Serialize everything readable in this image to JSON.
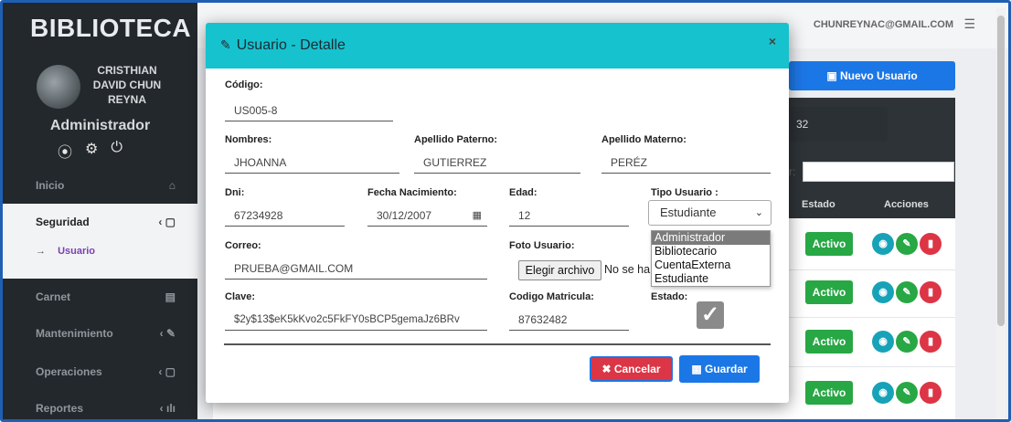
{
  "app": {
    "brand": "BIBLIOTECA"
  },
  "user": {
    "name": "CRISTHIAN DAVID CHUN REYNA",
    "role": "Administrador",
    "icons": [
      "user-circle-icon",
      "gear-icon",
      "power-icon"
    ]
  },
  "topbar": {
    "email": "CHUNREYNAC@GMAIL.COM",
    "menu_icon": "list-icon"
  },
  "sidebar": {
    "items": [
      {
        "label": "Inicio",
        "icon": "home-icon",
        "glyph": "⌂"
      },
      {
        "label": "Seguridad",
        "icon": "folder-icon",
        "glyph": "‹ ▢"
      },
      {
        "label": "Carnet",
        "icon": "id-card-icon",
        "glyph": "▤"
      },
      {
        "label": "Mantenimiento",
        "icon": "wrench-icon",
        "glyph": "‹ ✎"
      },
      {
        "label": "Operaciones",
        "icon": "folder-icon",
        "glyph": "‹ ▢"
      },
      {
        "label": "Reportes",
        "icon": "chart-icon",
        "glyph": "‹ ılı"
      }
    ],
    "subitem": {
      "label": "Usuario",
      "arrow": "→"
    }
  },
  "background": {
    "new_button": "Nuevo Usuario",
    "count": "32",
    "search_label": "r:",
    "headers": {
      "estado": "Estado",
      "acciones": "Acciones"
    },
    "rows": [
      {
        "estado": "Activo"
      },
      {
        "estado": "Activo"
      },
      {
        "estado": "Activo"
      },
      {
        "estado": "Activo"
      }
    ]
  },
  "modal": {
    "title": "Usuario - Detalle",
    "close": "×",
    "fields": {
      "codigo": {
        "label": "Código:",
        "value": "US005-8"
      },
      "nombres": {
        "label": "Nombres:",
        "value": "JHOANNA"
      },
      "apellido_paterno": {
        "label": "Apellido Paterno:",
        "value": "GUTIERREZ"
      },
      "apellido_materno": {
        "label": "Apellido Materno:",
        "value": "PERÉZ"
      },
      "dni": {
        "label": "Dni:",
        "value": "67234928"
      },
      "fecha_nacimiento": {
        "label": "Fecha Nacimiento:",
        "value": "30/12/2007"
      },
      "edad": {
        "label": "Edad:",
        "value": "12"
      },
      "tipo_usuario": {
        "label": "Tipo Usuario :",
        "value": "Estudiante",
        "options": [
          "Administrador",
          "Bibliotecario",
          "CuentaExterna",
          "Estudiante"
        ],
        "highlighted": "Administrador"
      },
      "correo": {
        "label": "Correo:",
        "value": "PRUEBA@GMAIL.COM"
      },
      "foto_usuario": {
        "label": "Foto Usuario:",
        "button": "Elegir archivo",
        "status": "No se ha"
      },
      "clave": {
        "label": "Clave:",
        "value": "$2y$13$eK5kKvo2c5FkFY0sBCP5gemaJz6BRv"
      },
      "codigo_matricula": {
        "label": "Codigo Matricula:",
        "value": "87632482"
      },
      "estado": {
        "label": "Estado:",
        "checked": true
      }
    },
    "buttons": {
      "cancel": "Cancelar",
      "save": "Guardar"
    }
  }
}
